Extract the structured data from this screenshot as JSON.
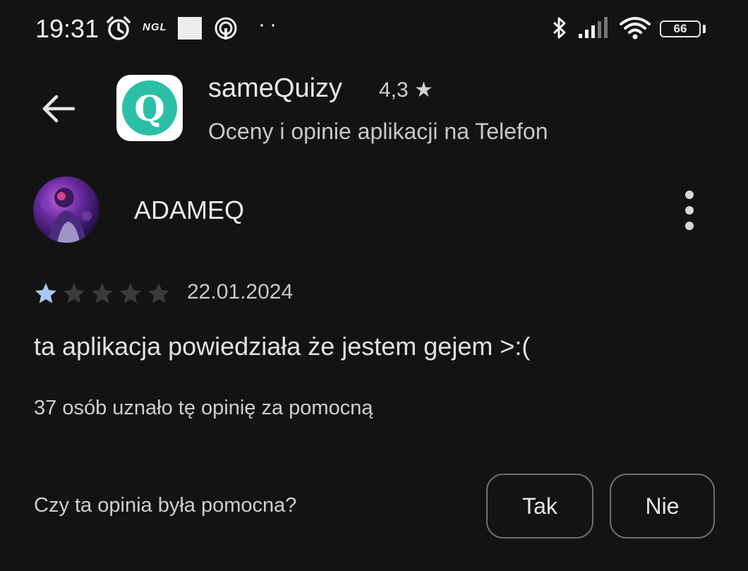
{
  "status_bar": {
    "time": "19:31",
    "ngl_label": "NGL",
    "dots": "··",
    "battery": "66",
    "icons": [
      "alarm-icon",
      "ngl-icon",
      "white-square-icon",
      "hotspot-icon",
      "bluetooth-icon",
      "signal-icon",
      "wifi-icon",
      "battery-icon"
    ]
  },
  "header": {
    "back_icon": "arrow-back-icon",
    "app_icon_letter": "Q",
    "app_name": "sameQuizy",
    "rating": "4,3 ★",
    "subtitle": "Oceny i opinie aplikacji na Telefon",
    "colors": {
      "app_icon_bg": "#2bc0a6"
    }
  },
  "review": {
    "author": "ADAMEQ",
    "stars_filled": 1,
    "stars_total": 5,
    "date": "22.01.2024",
    "text": "ta aplikacja powiedziała że jestem gejem >:(",
    "helpful_count": "37 osób uznało tę opinię za pomocną",
    "colors": {
      "star_filled": "#a8c7fa",
      "star_empty": "#3a3a3a"
    }
  },
  "feedback": {
    "question": "Czy ta opinia była pomocna?",
    "yes_label": "Tak",
    "no_label": "Nie"
  }
}
